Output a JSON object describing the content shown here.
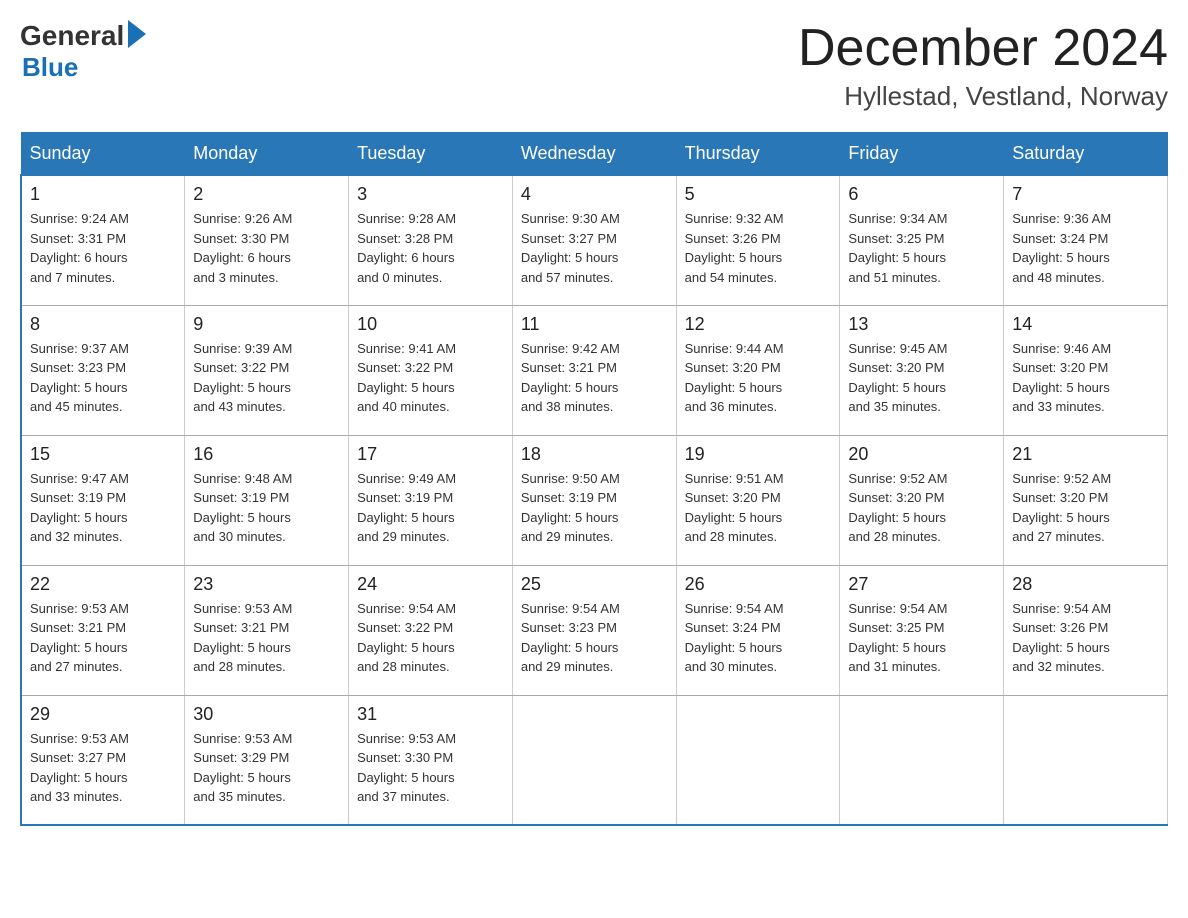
{
  "logo": {
    "general": "General",
    "blue": "Blue"
  },
  "header": {
    "month": "December 2024",
    "location": "Hyllestad, Vestland, Norway"
  },
  "weekdays": [
    "Sunday",
    "Monday",
    "Tuesday",
    "Wednesday",
    "Thursday",
    "Friday",
    "Saturday"
  ],
  "weeks": [
    [
      {
        "day": "1",
        "info": "Sunrise: 9:24 AM\nSunset: 3:31 PM\nDaylight: 6 hours\nand 7 minutes."
      },
      {
        "day": "2",
        "info": "Sunrise: 9:26 AM\nSunset: 3:30 PM\nDaylight: 6 hours\nand 3 minutes."
      },
      {
        "day": "3",
        "info": "Sunrise: 9:28 AM\nSunset: 3:28 PM\nDaylight: 6 hours\nand 0 minutes."
      },
      {
        "day": "4",
        "info": "Sunrise: 9:30 AM\nSunset: 3:27 PM\nDaylight: 5 hours\nand 57 minutes."
      },
      {
        "day": "5",
        "info": "Sunrise: 9:32 AM\nSunset: 3:26 PM\nDaylight: 5 hours\nand 54 minutes."
      },
      {
        "day": "6",
        "info": "Sunrise: 9:34 AM\nSunset: 3:25 PM\nDaylight: 5 hours\nand 51 minutes."
      },
      {
        "day": "7",
        "info": "Sunrise: 9:36 AM\nSunset: 3:24 PM\nDaylight: 5 hours\nand 48 minutes."
      }
    ],
    [
      {
        "day": "8",
        "info": "Sunrise: 9:37 AM\nSunset: 3:23 PM\nDaylight: 5 hours\nand 45 minutes."
      },
      {
        "day": "9",
        "info": "Sunrise: 9:39 AM\nSunset: 3:22 PM\nDaylight: 5 hours\nand 43 minutes."
      },
      {
        "day": "10",
        "info": "Sunrise: 9:41 AM\nSunset: 3:22 PM\nDaylight: 5 hours\nand 40 minutes."
      },
      {
        "day": "11",
        "info": "Sunrise: 9:42 AM\nSunset: 3:21 PM\nDaylight: 5 hours\nand 38 minutes."
      },
      {
        "day": "12",
        "info": "Sunrise: 9:44 AM\nSunset: 3:20 PM\nDaylight: 5 hours\nand 36 minutes."
      },
      {
        "day": "13",
        "info": "Sunrise: 9:45 AM\nSunset: 3:20 PM\nDaylight: 5 hours\nand 35 minutes."
      },
      {
        "day": "14",
        "info": "Sunrise: 9:46 AM\nSunset: 3:20 PM\nDaylight: 5 hours\nand 33 minutes."
      }
    ],
    [
      {
        "day": "15",
        "info": "Sunrise: 9:47 AM\nSunset: 3:19 PM\nDaylight: 5 hours\nand 32 minutes."
      },
      {
        "day": "16",
        "info": "Sunrise: 9:48 AM\nSunset: 3:19 PM\nDaylight: 5 hours\nand 30 minutes."
      },
      {
        "day": "17",
        "info": "Sunrise: 9:49 AM\nSunset: 3:19 PM\nDaylight: 5 hours\nand 29 minutes."
      },
      {
        "day": "18",
        "info": "Sunrise: 9:50 AM\nSunset: 3:19 PM\nDaylight: 5 hours\nand 29 minutes."
      },
      {
        "day": "19",
        "info": "Sunrise: 9:51 AM\nSunset: 3:20 PM\nDaylight: 5 hours\nand 28 minutes."
      },
      {
        "day": "20",
        "info": "Sunrise: 9:52 AM\nSunset: 3:20 PM\nDaylight: 5 hours\nand 28 minutes."
      },
      {
        "day": "21",
        "info": "Sunrise: 9:52 AM\nSunset: 3:20 PM\nDaylight: 5 hours\nand 27 minutes."
      }
    ],
    [
      {
        "day": "22",
        "info": "Sunrise: 9:53 AM\nSunset: 3:21 PM\nDaylight: 5 hours\nand 27 minutes."
      },
      {
        "day": "23",
        "info": "Sunrise: 9:53 AM\nSunset: 3:21 PM\nDaylight: 5 hours\nand 28 minutes."
      },
      {
        "day": "24",
        "info": "Sunrise: 9:54 AM\nSunset: 3:22 PM\nDaylight: 5 hours\nand 28 minutes."
      },
      {
        "day": "25",
        "info": "Sunrise: 9:54 AM\nSunset: 3:23 PM\nDaylight: 5 hours\nand 29 minutes."
      },
      {
        "day": "26",
        "info": "Sunrise: 9:54 AM\nSunset: 3:24 PM\nDaylight: 5 hours\nand 30 minutes."
      },
      {
        "day": "27",
        "info": "Sunrise: 9:54 AM\nSunset: 3:25 PM\nDaylight: 5 hours\nand 31 minutes."
      },
      {
        "day": "28",
        "info": "Sunrise: 9:54 AM\nSunset: 3:26 PM\nDaylight: 5 hours\nand 32 minutes."
      }
    ],
    [
      {
        "day": "29",
        "info": "Sunrise: 9:53 AM\nSunset: 3:27 PM\nDaylight: 5 hours\nand 33 minutes."
      },
      {
        "day": "30",
        "info": "Sunrise: 9:53 AM\nSunset: 3:29 PM\nDaylight: 5 hours\nand 35 minutes."
      },
      {
        "day": "31",
        "info": "Sunrise: 9:53 AM\nSunset: 3:30 PM\nDaylight: 5 hours\nand 37 minutes."
      },
      null,
      null,
      null,
      null
    ]
  ]
}
